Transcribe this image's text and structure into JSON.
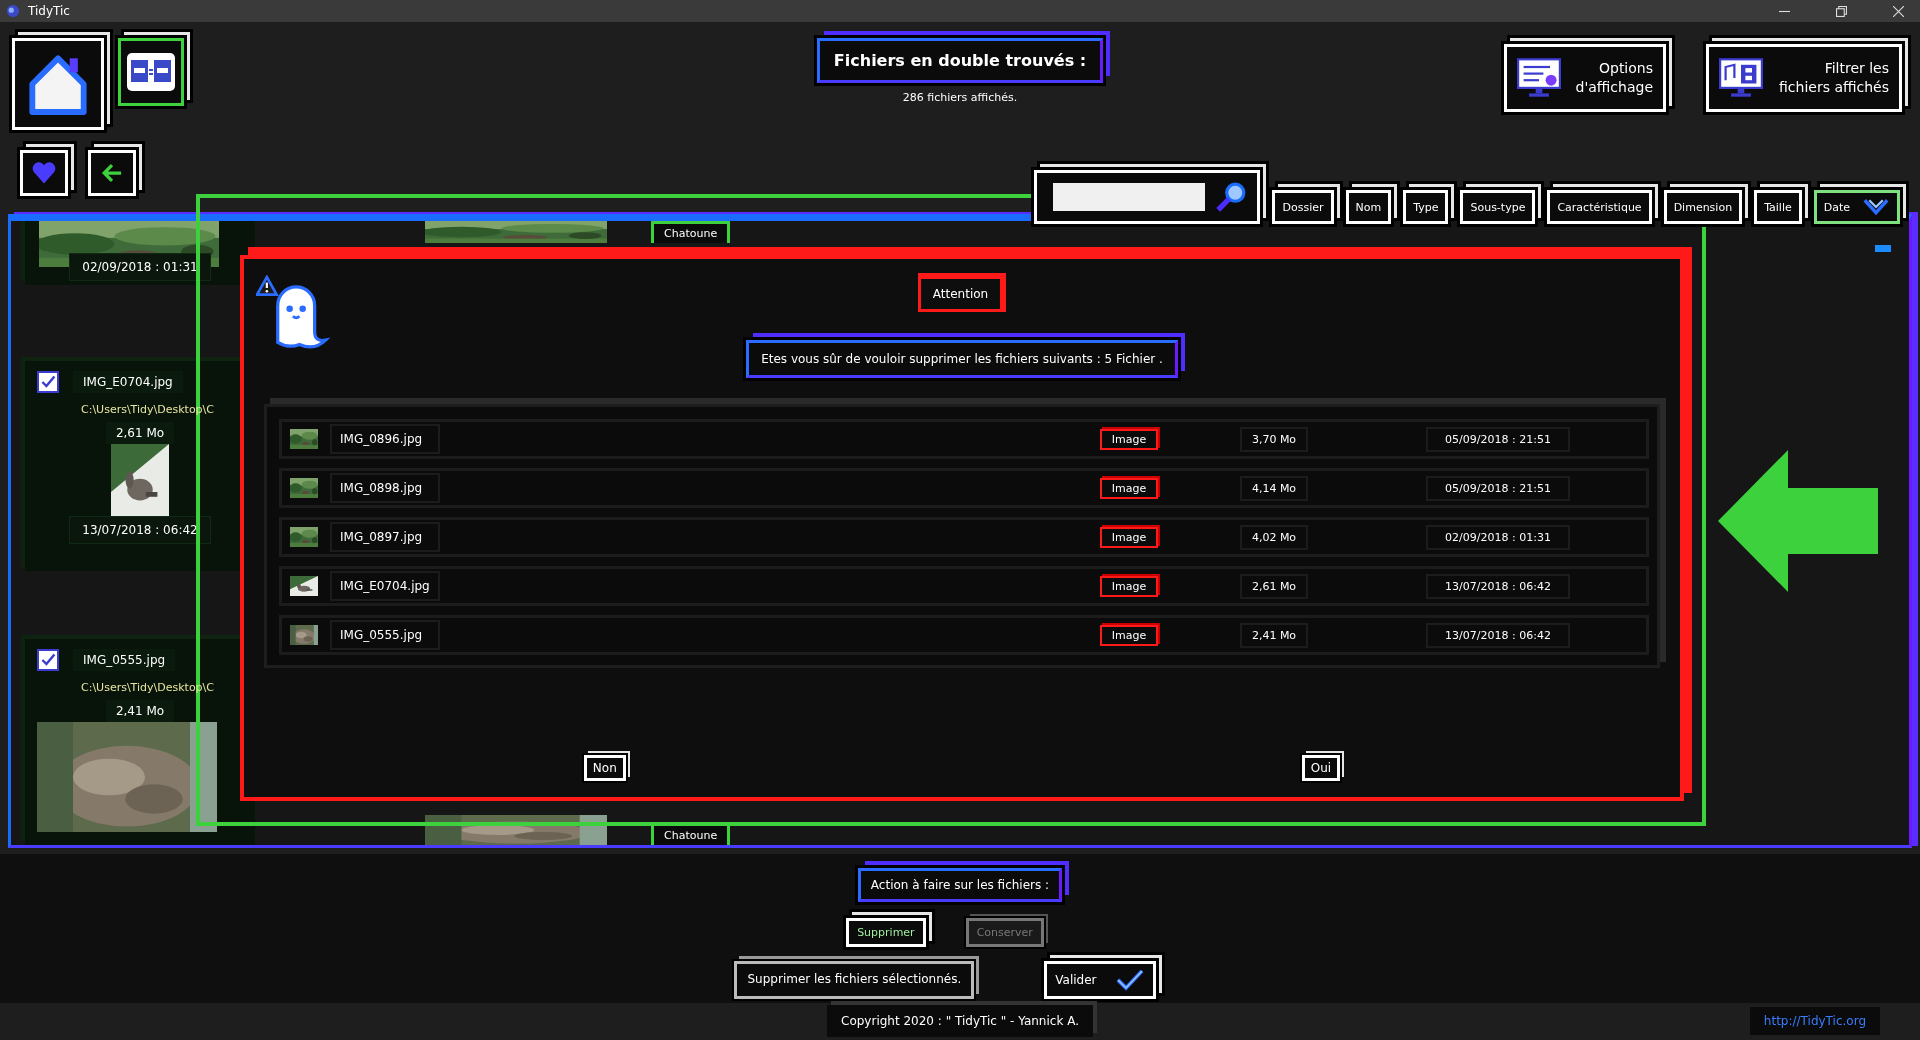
{
  "window": {
    "title": "TidyTic"
  },
  "header": {
    "title": "Fichiers en double trouvés :",
    "subtitle": "286 fichiers affichés."
  },
  "top_buttons": [
    {
      "kind": "options",
      "label": "Options d'affichage"
    },
    {
      "kind": "filter",
      "label": "Filtrer les fichiers affichés"
    }
  ],
  "sort_buttons": [
    {
      "label": "Dossier",
      "selected": false
    },
    {
      "label": "Nom",
      "selected": false
    },
    {
      "label": "Type",
      "selected": false
    },
    {
      "label": "Sous-type",
      "selected": false
    },
    {
      "label": "Caractéristique",
      "selected": false
    },
    {
      "label": "Dimension",
      "selected": false
    },
    {
      "label": "Taille",
      "selected": false
    },
    {
      "label": "Date",
      "selected": true
    }
  ],
  "file_cards": [
    {
      "kind": "partial",
      "date": "02/09/2018 : 01:31"
    },
    {
      "kind": "full",
      "checked": true,
      "name": "IMG_E0704.jpg",
      "path": "C:\\Users\\Tidy\\Desktop\\C",
      "size": "2,61 Mo",
      "date": "13/07/2018 : 06:42"
    },
    {
      "kind": "bottom",
      "checked": true,
      "name": "IMG_0555.jpg",
      "path": "C:\\Users\\Tidy\\Desktop\\C",
      "size": "2,41 Mo"
    }
  ],
  "tags": [
    "Chatoune",
    "Chatoune"
  ],
  "dialog": {
    "title": "Attention",
    "message": "Etes vous sûr de vouloir supprimer les fichiers suivants : 5 Fichier .",
    "rows": [
      {
        "name": "IMG_0896.jpg",
        "type": "Image",
        "size": "3,70 Mo",
        "date": "05/09/2018 : 21:51"
      },
      {
        "name": "IMG_0898.jpg",
        "type": "Image",
        "size": "4,14 Mo",
        "date": "05/09/2018 : 21:51"
      },
      {
        "name": "IMG_0897.jpg",
        "type": "Image",
        "size": "4,02 Mo",
        "date": "02/09/2018 : 01:31"
      },
      {
        "name": "IMG_E0704.jpg",
        "type": "Image",
        "size": "2,61 Mo",
        "date": "13/07/2018 : 06:42"
      },
      {
        "name": "IMG_0555.jpg",
        "type": "Image",
        "size": "2,41 Mo",
        "date": "13/07/2018 : 06:42"
      }
    ],
    "buttons": [
      "Non",
      "Oui"
    ]
  },
  "actions": {
    "label": "Action à faire sur les fichiers :",
    "options": [
      {
        "label": "Supprimer",
        "selected": true
      },
      {
        "label": "Conserver",
        "selected": false
      }
    ],
    "summary": "Supprimer les fichiers sélectionnés.",
    "validate": "Valider"
  },
  "footer": {
    "copyright": "Copyright 2020 : \" TidyTic \" - Yannick A.",
    "link": "http://TidyTic.org"
  }
}
